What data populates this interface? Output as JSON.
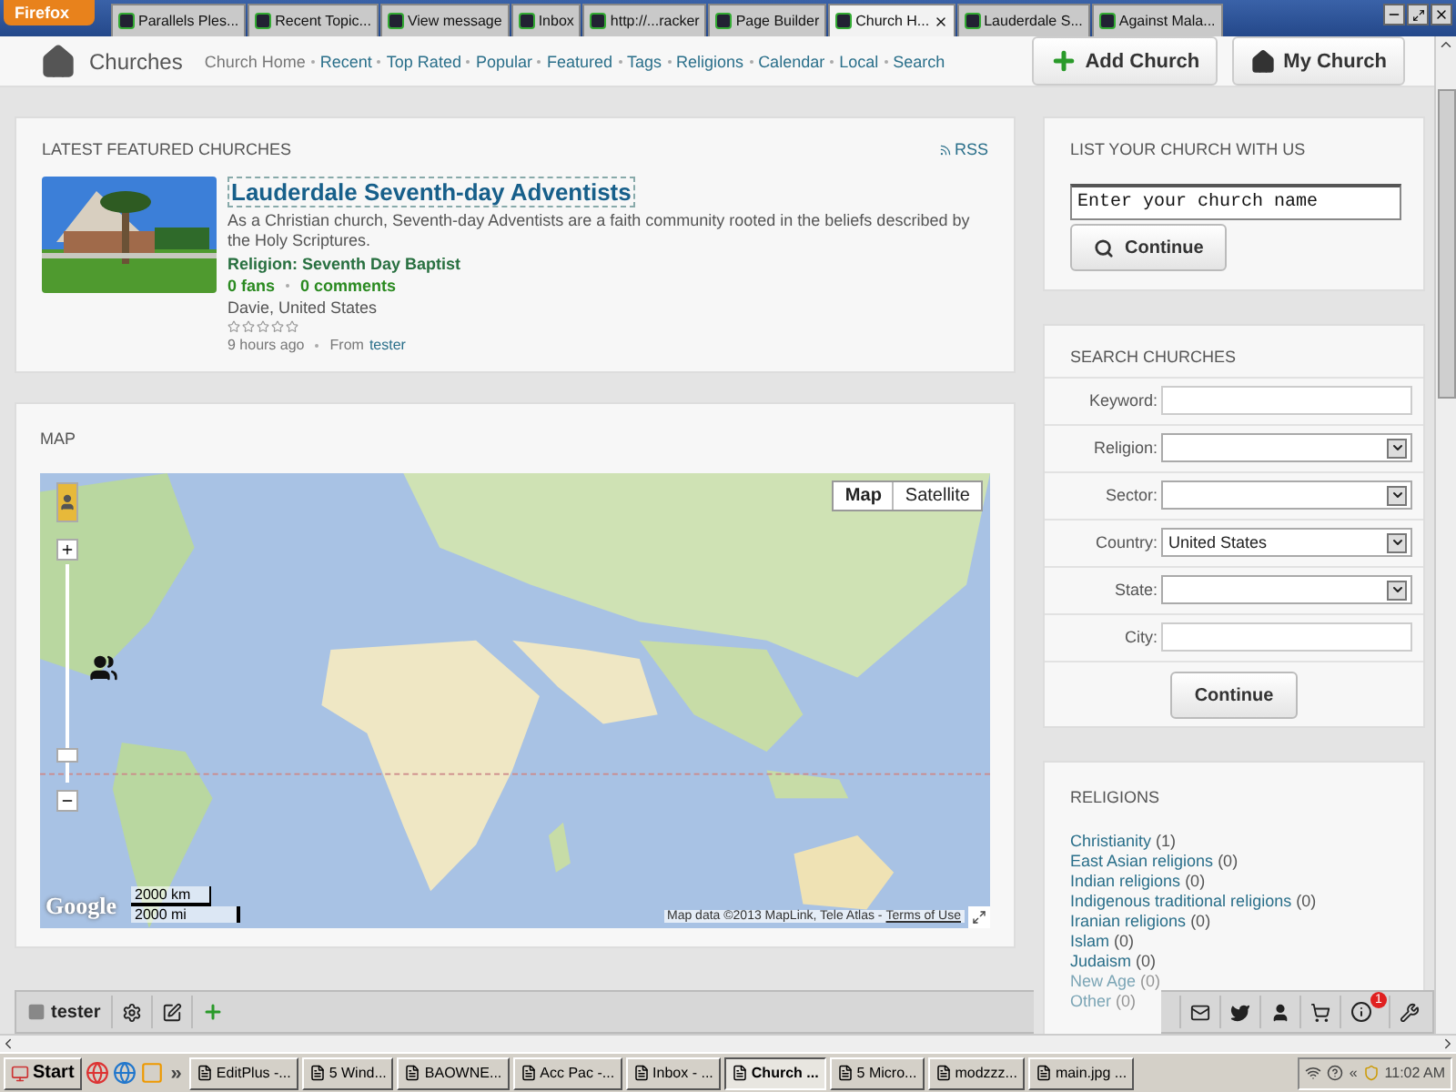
{
  "browser": {
    "menu_button": "Firefox",
    "tabs": [
      {
        "label": "Parallels Ples...",
        "selected": false
      },
      {
        "label": "Recent Topic...",
        "selected": false
      },
      {
        "label": "View message",
        "selected": false
      },
      {
        "label": "Inbox",
        "selected": false
      },
      {
        "label": "http://...racker",
        "selected": false
      },
      {
        "label": "Page Builder",
        "selected": false
      },
      {
        "label": "Church H...",
        "selected": true
      },
      {
        "label": "Lauderdale S...",
        "selected": false
      },
      {
        "label": "Against Mala...",
        "selected": false
      }
    ]
  },
  "site": {
    "title": "Churches",
    "nav": [
      {
        "label": "Church Home",
        "selected": true
      },
      {
        "label": "Recent",
        "selected": false
      },
      {
        "label": "Top Rated",
        "selected": false
      },
      {
        "label": "Popular",
        "selected": false
      },
      {
        "label": "Featured",
        "selected": false
      },
      {
        "label": "Tags",
        "selected": false
      },
      {
        "label": "Religions",
        "selected": false
      },
      {
        "label": "Calendar",
        "selected": false
      },
      {
        "label": "Local",
        "selected": false
      },
      {
        "label": "Search",
        "selected": false
      }
    ],
    "buttons": [
      {
        "label": "Add Church",
        "kind": "add"
      },
      {
        "label": "My Church",
        "kind": "home"
      }
    ]
  },
  "featured": {
    "heading": "LATEST FEATURED CHURCHES",
    "rss": "RSS",
    "church": {
      "kind": "picture",
      "name": "Lauderdale Seventh-day Adventists",
      "description": "As a Christian church, Seventh-day Adventists are a faith community rooted in the beliefs described by the Holy Scriptures.",
      "religion": "Religion: Seventh Day Baptist",
      "fans": "0 fans",
      "comments": "0 comments",
      "location": "Davie, United States",
      "stars": 0,
      "posted": "9 hours ago",
      "from_label": "From",
      "author": "tester"
    }
  },
  "map": {
    "heading": "MAP",
    "types": [
      {
        "label": "Map",
        "selected": true
      },
      {
        "label": "Satellite",
        "selected": false
      }
    ],
    "zoom": {
      "level": 0.1
    },
    "logo": "Google",
    "scale": [
      "2000 km",
      "2000 mi"
    ],
    "attribution": "Map data ©2013 MapLink, Tele Atlas -",
    "terms": "Terms of Use"
  },
  "list_church": {
    "heading": "LIST YOUR CHURCH WITH US",
    "placeholder": "Enter your church name",
    "button": "Continue"
  },
  "search": {
    "heading": "SEARCH CHURCHES",
    "fields": [
      {
        "label": "Keyword:",
        "kind": "text"
      },
      {
        "label": "Religion:",
        "kind": "select"
      },
      {
        "label": "Sector:",
        "kind": "select"
      },
      {
        "label": "Country:",
        "kind": "select",
        "value": "United States"
      },
      {
        "label": "State:",
        "kind": "select"
      },
      {
        "label": "City:",
        "kind": "text"
      }
    ],
    "button": "Continue"
  },
  "religions": {
    "heading": "RELIGIONS",
    "items": [
      {
        "name": "Christianity",
        "count": "(1)"
      },
      {
        "name": "East Asian religions",
        "count": "(0)"
      },
      {
        "name": "Indian religions",
        "count": "(0)"
      },
      {
        "name": "Indigenous traditional religions",
        "count": "(0)"
      },
      {
        "name": "Iranian religions",
        "count": "(0)"
      },
      {
        "name": "Islam",
        "count": "(0)"
      },
      {
        "name": "Judaism",
        "count": "(0)"
      },
      {
        "name": "New Age",
        "count": "(0)"
      },
      {
        "name": "Other",
        "count": "(0)"
      }
    ]
  },
  "toolbar": {
    "user": "tester",
    "badge": "1"
  },
  "taskbar": {
    "start": "Start",
    "more": "»",
    "items": [
      {
        "label": "EditPlus -...",
        "selected": false
      },
      {
        "label": "5 Wind...",
        "selected": false
      },
      {
        "label": "BAOWNE...",
        "selected": false
      },
      {
        "label": "Acc Pac -...",
        "selected": false
      },
      {
        "label": "Inbox - ...",
        "selected": false
      },
      {
        "label": "Church ...",
        "selected": true
      },
      {
        "label": "5 Micro...",
        "selected": false
      },
      {
        "label": "modzzz...",
        "selected": false
      },
      {
        "label": "main.jpg ...",
        "selected": false
      }
    ],
    "tray_more": "«",
    "clock": "11:02 AM"
  }
}
